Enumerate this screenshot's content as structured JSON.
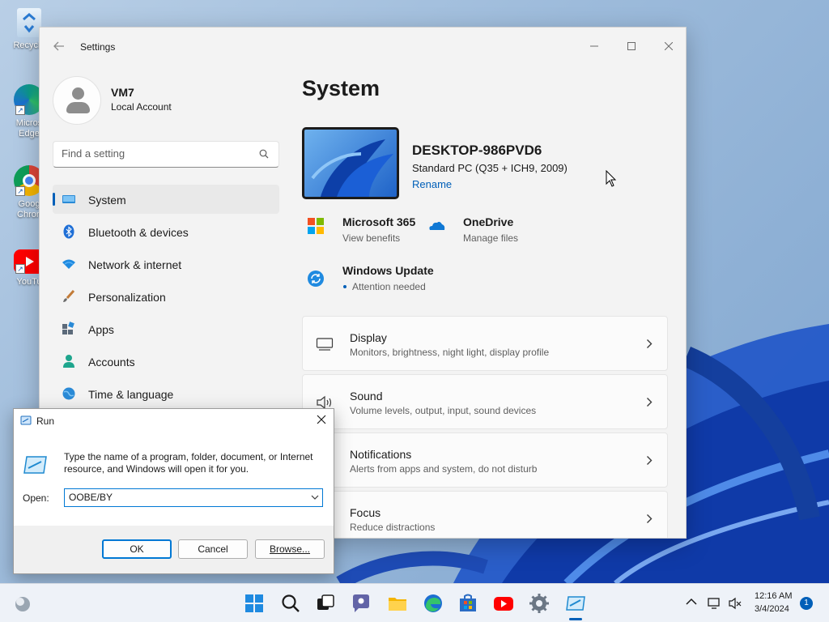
{
  "desktop": {
    "icons": [
      {
        "label": "Recycle",
        "icon": "recycle-bin-icon"
      },
      {
        "label": "Micros\nEdge",
        "icon": "edge-icon"
      },
      {
        "label": "Goog\nChron",
        "icon": "chrome-icon"
      },
      {
        "label": "YouTu",
        "icon": "youtube-icon"
      }
    ]
  },
  "settings": {
    "title": "Settings",
    "user": {
      "name": "VM7",
      "type": "Local Account"
    },
    "search_placeholder": "Find a setting",
    "nav": [
      {
        "label": "System",
        "icon": "monitor-icon",
        "active": true
      },
      {
        "label": "Bluetooth & devices",
        "icon": "bluetooth-icon"
      },
      {
        "label": "Network & internet",
        "icon": "wifi-icon"
      },
      {
        "label": "Personalization",
        "icon": "brush-icon"
      },
      {
        "label": "Apps",
        "icon": "apps-icon"
      },
      {
        "label": "Accounts",
        "icon": "person-icon"
      },
      {
        "label": "Time & language",
        "icon": "globe-icon"
      }
    ],
    "page_title": "System",
    "device": {
      "name": "DESKTOP-986PVD6",
      "model": "Standard PC (Q35 + ICH9, 2009)",
      "rename": "Rename"
    },
    "quick_links": [
      {
        "title": "Microsoft 365",
        "sub": "View benefits",
        "icon": "microsoft-365-icon"
      },
      {
        "title": "OneDrive",
        "sub": "Manage files",
        "icon": "onedrive-icon"
      },
      {
        "title": "Windows Update",
        "sub": "Attention needed",
        "icon": "windows-update-icon"
      }
    ],
    "cards": [
      {
        "title": "Display",
        "sub": "Monitors, brightness, night light, display profile",
        "icon": "display-icon"
      },
      {
        "title": "Sound",
        "sub": "Volume levels, output, input, sound devices",
        "icon": "speaker-icon"
      },
      {
        "title": "Notifications",
        "sub": "Alerts from apps and system, do not disturb",
        "icon": "bell-icon"
      },
      {
        "title": "Focus",
        "sub": "Reduce distractions",
        "icon": "focus-icon"
      }
    ]
  },
  "run": {
    "title": "Run",
    "description": "Type the name of a program, folder, document, or Internet resource, and Windows will open it for you.",
    "open_label": "Open:",
    "value": "OOBE/BY",
    "buttons": {
      "ok": "OK",
      "cancel": "Cancel",
      "browse": "Browse..."
    }
  },
  "taskbar": {
    "apps": [
      "start-icon",
      "search-icon",
      "task-view-icon",
      "chat-icon",
      "file-explorer-icon",
      "edge-icon",
      "store-icon",
      "youtube-icon",
      "settings-icon",
      "run-icon"
    ],
    "time": "12:16 AM",
    "date": "3/4/2024",
    "notification_count": "1"
  },
  "colors": {
    "accent": "#005fb8",
    "window_bg": "#f3f3f3",
    "card_bg": "#fbfbfb"
  }
}
